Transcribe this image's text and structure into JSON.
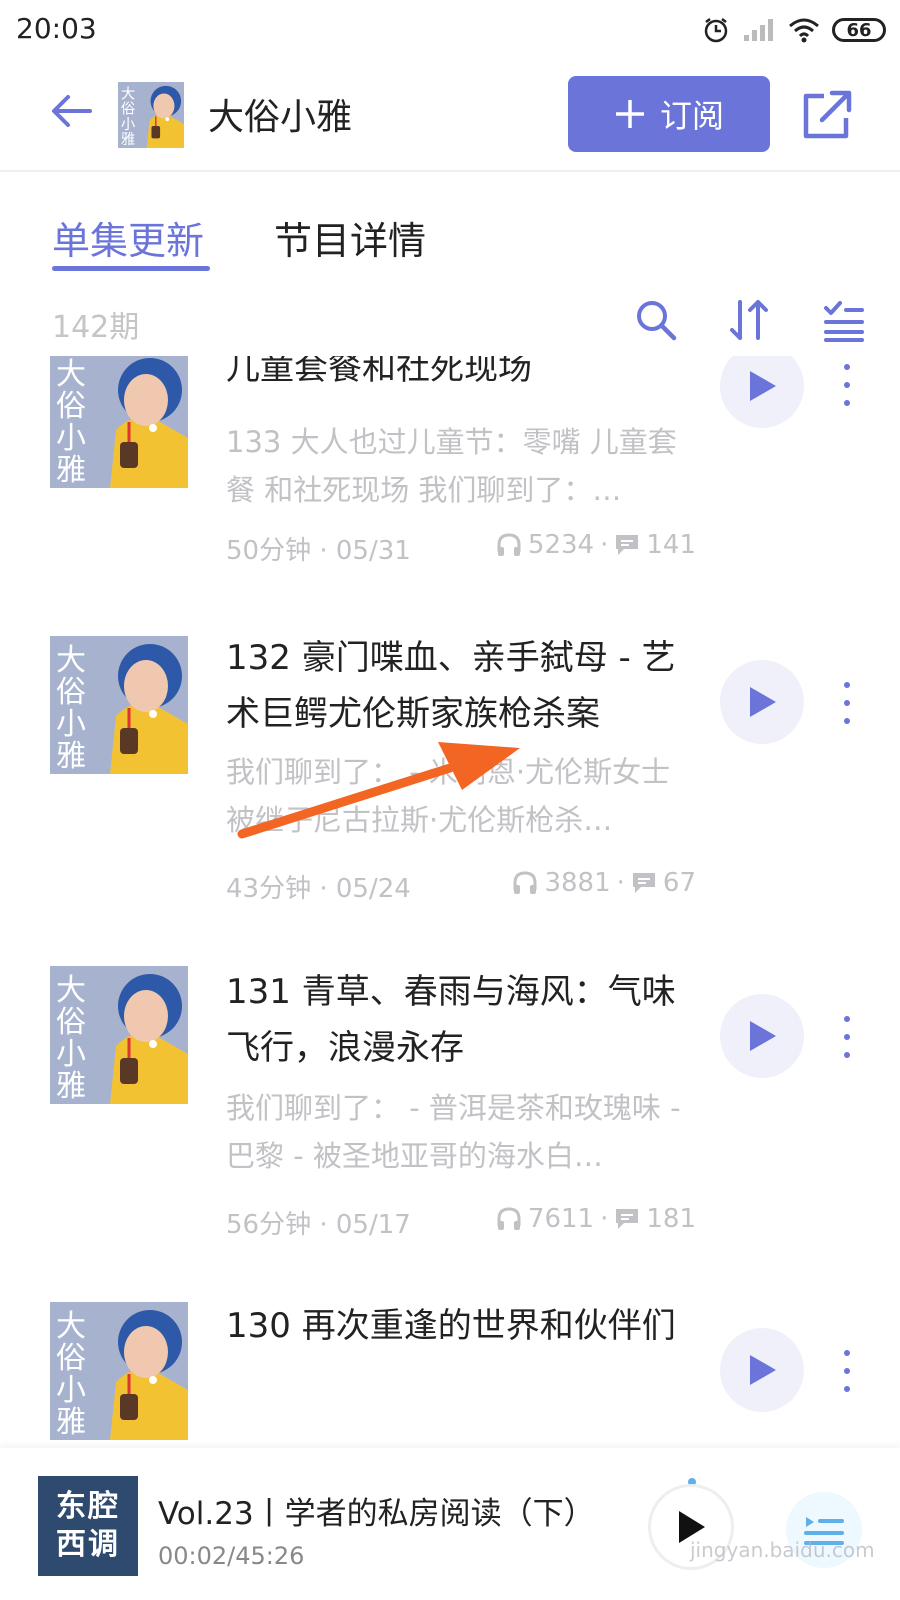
{
  "status_bar": {
    "time": "20:03",
    "battery": "66"
  },
  "header": {
    "podcast_title": "大俗小雅",
    "subscribe_label": "订阅",
    "cover_text": [
      "大",
      "俗",
      "小",
      "雅"
    ]
  },
  "tabs": [
    {
      "label": "单集更新",
      "active": true
    },
    {
      "label": "节目详情",
      "active": false
    }
  ],
  "list_header": {
    "count": "142期"
  },
  "episodes": [
    {
      "title": "儿童套餐和社死现场",
      "description": "133 大人也过儿童节：零嘴 儿童套餐 和社死现场 我们聊到了：…",
      "duration_date": "50分钟 · 05/31",
      "plays": "5234",
      "comments": "141"
    },
    {
      "title": "132 豪门喋血、亲手弑母 - 艺术巨鳄尤伦斯家族枪杀案",
      "description": "我们聊到了： - 米莉恩·尤伦斯女士被继子尼古拉斯·尤伦斯枪杀…",
      "duration_date": "43分钟 · 05/24",
      "plays": "3881",
      "comments": "67"
    },
    {
      "title": "131 青草、春雨与海风：气味飞行，浪漫永存",
      "description": "我们聊到了： - 普洱是茶和玫瑰味 - 巴黎 - 被圣地亚哥的海水白…",
      "duration_date": "56分钟 · 05/17",
      "plays": "7611",
      "comments": "181"
    },
    {
      "title": "130 再次重逢的世界和伙伴们",
      "description": "",
      "duration_date": "",
      "plays": "",
      "comments": ""
    }
  ],
  "player": {
    "cover_text": [
      "东腔",
      "西调"
    ],
    "title": "Vol.23丨学者的私房阅读（下）",
    "time": "00:02/45:26"
  },
  "watermark": "jingyan.baidu.com",
  "colors": {
    "accent": "#6b74d9",
    "muted": "#c2c2c6",
    "annotation_arrow": "#f26522"
  }
}
